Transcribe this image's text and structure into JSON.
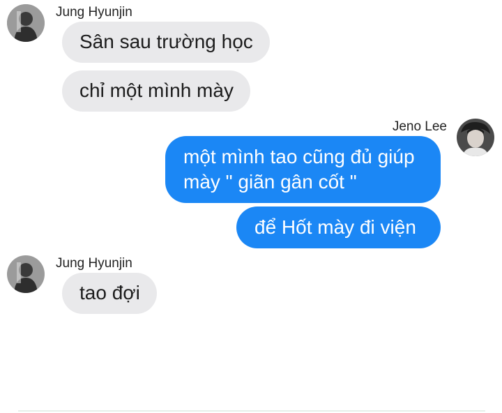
{
  "messages": [
    {
      "sender": "Jung Hyunjin",
      "direction": "incoming",
      "bubbles": [
        "Sân sau trường học",
        "chỉ một mình mày"
      ]
    },
    {
      "sender": "Jeno Lee",
      "direction": "outgoing",
      "bubbles": [
        [
          "một mình tao cũng đủ giúp",
          "mày \" giãn gân cốt \""
        ],
        "để Hốt mày đi viện"
      ]
    },
    {
      "sender": "Jung Hyunjin",
      "direction": "incoming",
      "bubbles": [
        "tao đợi"
      ]
    }
  ],
  "colors": {
    "incoming_bubble": "#e9e9eb",
    "outgoing_bubble": "#1b87f5",
    "outgoing_text": "#ffffff",
    "incoming_text": "#1c1c1c"
  },
  "icons": {
    "incoming_avatar": "profile-photo-avatar",
    "outgoing_avatar": "profile-photo-avatar"
  }
}
